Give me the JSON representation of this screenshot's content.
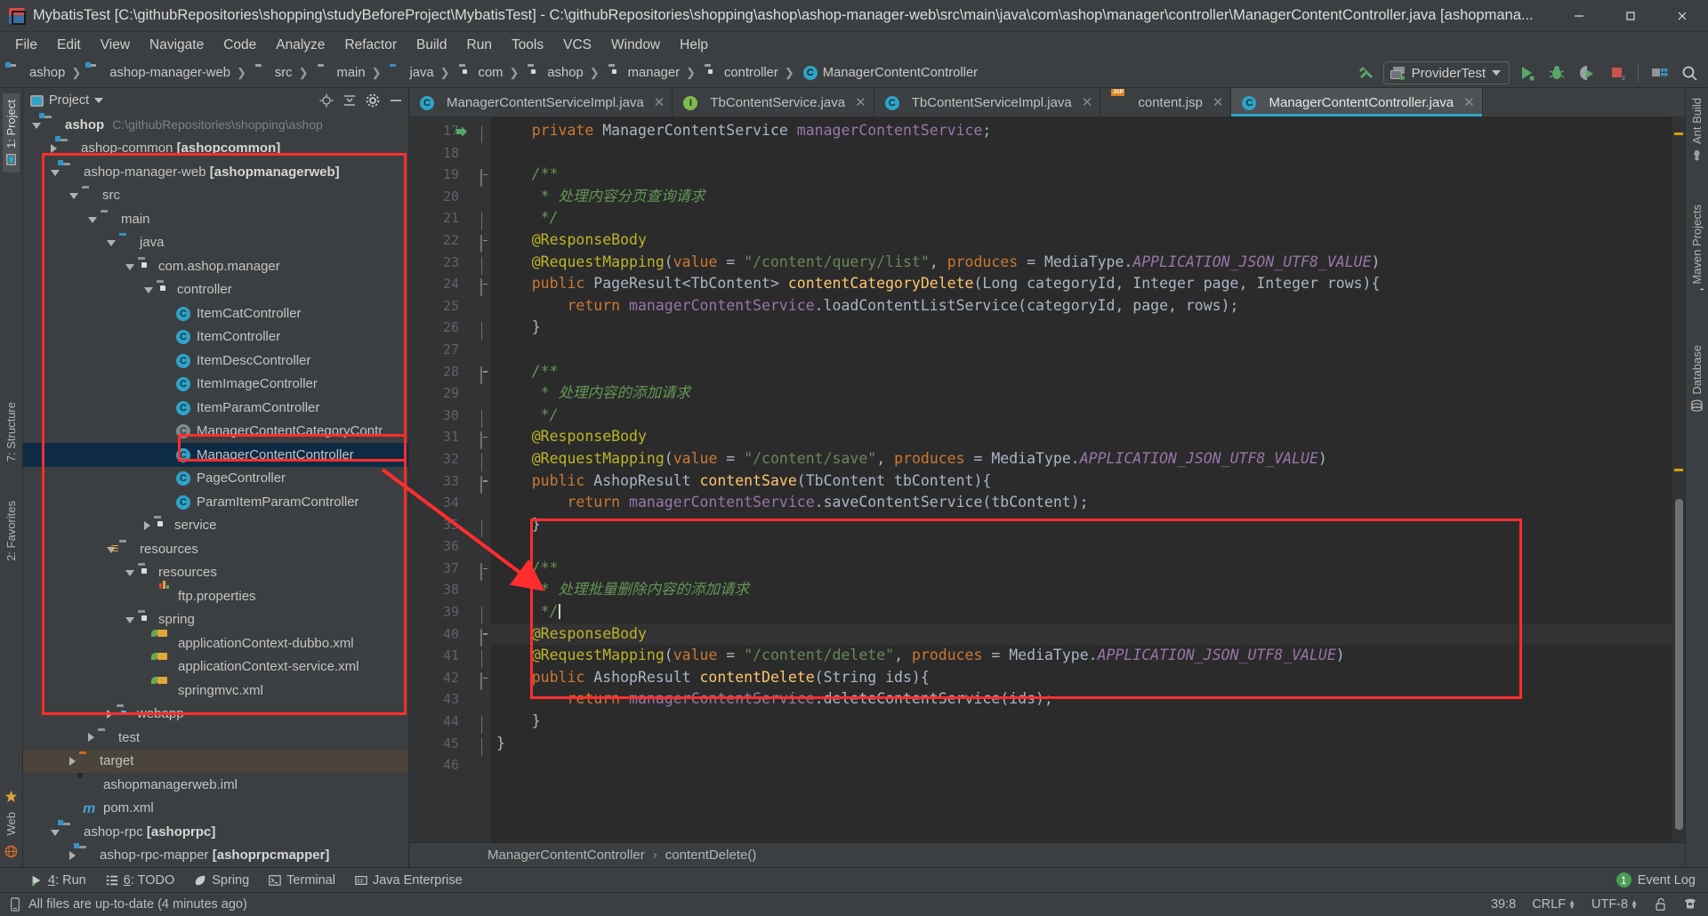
{
  "window": {
    "title": "MybatisTest [C:\\githubRepositories\\shopping\\studyBeforeProject\\MybatisTest] - C:\\githubRepositories\\shopping\\ashop\\ashop-manager-web\\src\\main\\java\\com\\ashop\\manager\\controller\\ManagerContentController.java [ashopmana...",
    "app_icon": "intellij-idea-icon",
    "minimize": "–",
    "maximize": "❐",
    "close": "✕"
  },
  "menubar": [
    {
      "label": "File"
    },
    {
      "label": "Edit"
    },
    {
      "label": "View"
    },
    {
      "label": "Navigate"
    },
    {
      "label": "Code"
    },
    {
      "label": "Analyze"
    },
    {
      "label": "Refactor"
    },
    {
      "label": "Build"
    },
    {
      "label": "Run"
    },
    {
      "label": "Tools"
    },
    {
      "label": "VCS"
    },
    {
      "label": "Window"
    },
    {
      "label": "Help"
    }
  ],
  "navbar": {
    "crumbs": [
      {
        "label": "ashop",
        "icon": "module-folder-icon",
        "active": false
      },
      {
        "label": "ashop-manager-web",
        "icon": "module-folder-icon",
        "active": false
      },
      {
        "label": "src",
        "icon": "folder-icon",
        "active": false
      },
      {
        "label": "main",
        "icon": "folder-icon",
        "active": false
      },
      {
        "label": "java",
        "icon": "source-folder-icon",
        "active": false
      },
      {
        "label": "com",
        "icon": "package-icon",
        "active": false
      },
      {
        "label": "ashop",
        "icon": "package-icon",
        "active": false
      },
      {
        "label": "manager",
        "icon": "package-icon",
        "active": false
      },
      {
        "label": "controller",
        "icon": "package-icon",
        "active": false
      },
      {
        "label": "ManagerContentController",
        "icon": "class-icon",
        "active": true
      }
    ],
    "run_config": "ProviderTest",
    "toolbar_icons": [
      "build-hammer-icon",
      "run-icon",
      "debug-icon",
      "run-with-coverage-icon",
      "stop-icon",
      "project-structure-icon",
      "search-everywhere-icon"
    ]
  },
  "left_rail": [
    {
      "label": "1: Project",
      "icon": "project-icon",
      "selected": true
    },
    {
      "label": "7: Structure",
      "icon": "structure-icon",
      "selected": false
    },
    {
      "label": "2: Favorites",
      "icon": "favorites-icon",
      "selected": false
    },
    {
      "label": "Web",
      "icon": "web-icon",
      "selected": false
    }
  ],
  "right_rail": [
    {
      "label": "Ant Build",
      "icon": "ant-icon"
    },
    {
      "label": "Maven Projects",
      "icon": "maven-icon"
    },
    {
      "label": "Database",
      "icon": "database-icon"
    }
  ],
  "project_panel": {
    "title": "Project",
    "actions": [
      "locate-icon",
      "collapse-all-icon",
      "settings-gear-icon",
      "hide-icon"
    ],
    "tree": [
      {
        "depth": 0,
        "arrow": "down",
        "icon": "module-folder-icon",
        "label": "ashop",
        "bold": true,
        "path": "C:\\githubRepositories\\shopping\\ashop",
        "state": "normal"
      },
      {
        "depth": 1,
        "arrow": "right",
        "icon": "module-folder-icon",
        "label": "ashop-common ",
        "boldsuffix": "[ashopcommon]",
        "state": "normal"
      },
      {
        "depth": 1,
        "arrow": "down",
        "icon": "module-folder-icon",
        "label": "ashop-manager-web ",
        "boldsuffix": "[ashopmanagerweb]",
        "state": "normal"
      },
      {
        "depth": 2,
        "arrow": "down",
        "icon": "folder-icon",
        "label": "src",
        "state": "normal"
      },
      {
        "depth": 3,
        "arrow": "down",
        "icon": "folder-icon",
        "label": "main",
        "state": "normal"
      },
      {
        "depth": 4,
        "arrow": "down",
        "icon": "source-folder-icon",
        "label": "java",
        "state": "normal"
      },
      {
        "depth": 5,
        "arrow": "down",
        "icon": "package-icon",
        "label": "com.ashop.manager",
        "state": "normal"
      },
      {
        "depth": 6,
        "arrow": "down",
        "icon": "package-icon",
        "label": "controller",
        "state": "normal"
      },
      {
        "depth": 7,
        "arrow": "none",
        "icon": "class-icon",
        "label": "ItemCatController",
        "state": "normal"
      },
      {
        "depth": 7,
        "arrow": "none",
        "icon": "class-icon",
        "label": "ItemController",
        "state": "normal"
      },
      {
        "depth": 7,
        "arrow": "none",
        "icon": "class-icon",
        "label": "ItemDescController",
        "state": "normal"
      },
      {
        "depth": 7,
        "arrow": "none",
        "icon": "class-icon",
        "label": "ItemImageController",
        "state": "normal"
      },
      {
        "depth": 7,
        "arrow": "none",
        "icon": "class-icon",
        "label": "ItemParamController",
        "state": "normal"
      },
      {
        "depth": 7,
        "arrow": "none",
        "icon": "class-icon-dim",
        "label": "ManagerContentCategoryContr",
        "state": "normal"
      },
      {
        "depth": 7,
        "arrow": "none",
        "icon": "class-icon",
        "label": "ManagerContentController",
        "state": "selected"
      },
      {
        "depth": 7,
        "arrow": "none",
        "icon": "class-icon",
        "label": "PageController",
        "state": "normal"
      },
      {
        "depth": 7,
        "arrow": "none",
        "icon": "class-icon",
        "label": "ParamItemParamController",
        "state": "normal"
      },
      {
        "depth": 6,
        "arrow": "right",
        "icon": "package-icon",
        "label": "service",
        "state": "normal"
      },
      {
        "depth": 4,
        "arrow": "down",
        "icon": "resources-folder-icon",
        "label": "resources",
        "state": "normal"
      },
      {
        "depth": 5,
        "arrow": "down",
        "icon": "package-icon",
        "label": "resources",
        "state": "normal"
      },
      {
        "depth": 6,
        "arrow": "none",
        "icon": "properties-icon",
        "label": "ftp.properties",
        "state": "normal"
      },
      {
        "depth": 5,
        "arrow": "down",
        "icon": "package-icon",
        "label": "spring",
        "state": "normal"
      },
      {
        "depth": 6,
        "arrow": "none",
        "icon": "xml-spring-icon",
        "label": "applicationContext-dubbo.xml",
        "state": "normal"
      },
      {
        "depth": 6,
        "arrow": "none",
        "icon": "xml-spring-icon",
        "label": "applicationContext-service.xml",
        "state": "normal"
      },
      {
        "depth": 6,
        "arrow": "none",
        "icon": "xml-spring-icon",
        "label": "springmvc.xml",
        "state": "normal"
      },
      {
        "depth": 4,
        "arrow": "right",
        "icon": "web-folder-icon",
        "label": "webapp",
        "state": "normal"
      },
      {
        "depth": 3,
        "arrow": "right",
        "icon": "folder-icon",
        "label": "test",
        "state": "normal"
      },
      {
        "depth": 2,
        "arrow": "right",
        "icon": "target-folder-icon",
        "label": "target",
        "state": "target"
      },
      {
        "depth": 2,
        "arrow": "none",
        "icon": "iml-icon",
        "label": "ashopmanagerweb.iml",
        "state": "normal"
      },
      {
        "depth": 2,
        "arrow": "none",
        "icon": "maven-pom-icon",
        "label": "pom.xml",
        "state": "normal"
      },
      {
        "depth": 1,
        "arrow": "down",
        "icon": "module-folder-icon",
        "label": "ashop-rpc ",
        "boldsuffix": "[ashoprpc]",
        "state": "normal"
      },
      {
        "depth": 2,
        "arrow": "right",
        "icon": "module-folder-icon",
        "label": "ashop-rpc-mapper ",
        "boldsuffix": "[ashoprpcmapper]",
        "state": "normal"
      }
    ]
  },
  "editor": {
    "tabs": [
      {
        "label": "ManagerContentServiceImpl.java",
        "icon": "class-icon",
        "active": false,
        "closable": true
      },
      {
        "label": "TbContentService.java",
        "icon": "interface-icon",
        "active": false,
        "closable": true
      },
      {
        "label": "TbContentServiceImpl.java",
        "icon": "class-icon",
        "active": false,
        "closable": true
      },
      {
        "label": "content.jsp",
        "icon": "jsp-icon",
        "active": false,
        "closable": true
      },
      {
        "label": "ManagerContentController.java",
        "icon": "class-icon",
        "active": true,
        "closable": true
      }
    ],
    "first_line_number": 17,
    "lines": [
      {
        "n": 17,
        "fold": "bracket",
        "green_arrow": true,
        "tokens": [
          {
            "t": "    ",
            "c": ""
          },
          {
            "t": "private",
            "c": "kw"
          },
          {
            "t": " ManagerContentService ",
            "c": "typ"
          },
          {
            "t": "managerContentService",
            "c": "fld"
          },
          {
            "t": ";",
            "c": ""
          }
        ]
      },
      {
        "n": 18,
        "fold": "",
        "tokens": []
      },
      {
        "n": 19,
        "fold": "box",
        "tokens": [
          {
            "t": "    ",
            "c": ""
          },
          {
            "t": "/**",
            "c": "cmt"
          }
        ]
      },
      {
        "n": 20,
        "fold": "",
        "tokens": [
          {
            "t": "     * 处理内容分页查询请求",
            "c": "cmt"
          }
        ]
      },
      {
        "n": 21,
        "fold": "bracket",
        "tokens": [
          {
            "t": "     */",
            "c": "cmt"
          }
        ]
      },
      {
        "n": 22,
        "fold": "box",
        "tokens": [
          {
            "t": "    ",
            "c": ""
          },
          {
            "t": "@ResponseBody",
            "c": "ann"
          }
        ]
      },
      {
        "n": 23,
        "fold": "bracket",
        "tokens": [
          {
            "t": "    ",
            "c": ""
          },
          {
            "t": "@RequestMapping",
            "c": "ann"
          },
          {
            "t": "(",
            "c": ""
          },
          {
            "t": "value",
            "c": "kw"
          },
          {
            "t": " = ",
            "c": ""
          },
          {
            "t": "\"/content/query/list\"",
            "c": "str"
          },
          {
            "t": ", ",
            "c": ""
          },
          {
            "t": "produces",
            "c": "kw"
          },
          {
            "t": " = MediaType.",
            "c": ""
          },
          {
            "t": "APPLICATION_JSON_UTF8_VALUE",
            "c": "sfld"
          },
          {
            "t": ")",
            "c": ""
          }
        ]
      },
      {
        "n": 24,
        "fold": "box",
        "tokens": [
          {
            "t": "    ",
            "c": ""
          },
          {
            "t": "public",
            "c": "kw"
          },
          {
            "t": " PageResult<TbContent> ",
            "c": "typ"
          },
          {
            "t": "contentCategoryDelete",
            "c": "mth"
          },
          {
            "t": "(Long categoryId, Integer page, Integer rows){",
            "c": ""
          }
        ]
      },
      {
        "n": 25,
        "fold": "",
        "tokens": [
          {
            "t": "        ",
            "c": ""
          },
          {
            "t": "return",
            "c": "kw"
          },
          {
            "t": " ",
            "c": ""
          },
          {
            "t": "managerContentService",
            "c": "fld"
          },
          {
            "t": ".loadContentListService(categoryId, page, rows);",
            "c": ""
          }
        ]
      },
      {
        "n": 26,
        "fold": "bracket",
        "tokens": [
          {
            "t": "    }",
            "c": ""
          }
        ]
      },
      {
        "n": 27,
        "fold": "",
        "tokens": []
      },
      {
        "n": 28,
        "fold": "box",
        "tokens": [
          {
            "t": "    ",
            "c": ""
          },
          {
            "t": "/**",
            "c": "cmt"
          }
        ]
      },
      {
        "n": 29,
        "fold": "",
        "tokens": [
          {
            "t": "     * 处理内容的添加请求",
            "c": "cmt"
          }
        ]
      },
      {
        "n": 30,
        "fold": "bracket",
        "tokens": [
          {
            "t": "     */",
            "c": "cmt"
          }
        ]
      },
      {
        "n": 31,
        "fold": "box",
        "tokens": [
          {
            "t": "    ",
            "c": ""
          },
          {
            "t": "@ResponseBody",
            "c": "ann"
          }
        ]
      },
      {
        "n": 32,
        "fold": "bracket",
        "tokens": [
          {
            "t": "    ",
            "c": ""
          },
          {
            "t": "@RequestMapping",
            "c": "ann"
          },
          {
            "t": "(",
            "c": ""
          },
          {
            "t": "value",
            "c": "kw"
          },
          {
            "t": " = ",
            "c": ""
          },
          {
            "t": "\"/content/save\"",
            "c": "str"
          },
          {
            "t": ", ",
            "c": ""
          },
          {
            "t": "produces",
            "c": "kw"
          },
          {
            "t": " = MediaType.",
            "c": ""
          },
          {
            "t": "APPLICATION_JSON_UTF8_VALUE",
            "c": "sfld"
          },
          {
            "t": ")",
            "c": ""
          }
        ]
      },
      {
        "n": 33,
        "fold": "box",
        "tokens": [
          {
            "t": "    ",
            "c": ""
          },
          {
            "t": "public",
            "c": "kw"
          },
          {
            "t": " AshopResult ",
            "c": "typ"
          },
          {
            "t": "contentSave",
            "c": "mth"
          },
          {
            "t": "(TbContent tbContent){",
            "c": ""
          }
        ]
      },
      {
        "n": 34,
        "fold": "",
        "tokens": [
          {
            "t": "        ",
            "c": ""
          },
          {
            "t": "return",
            "c": "kw"
          },
          {
            "t": " ",
            "c": ""
          },
          {
            "t": "managerContentService",
            "c": "fld"
          },
          {
            "t": ".saveContentService(tbContent);",
            "c": ""
          }
        ]
      },
      {
        "n": 35,
        "fold": "bracket",
        "tokens": [
          {
            "t": "    }",
            "c": ""
          }
        ]
      },
      {
        "n": 36,
        "fold": "",
        "tokens": []
      },
      {
        "n": 37,
        "fold": "box",
        "tokens": [
          {
            "t": "    ",
            "c": ""
          },
          {
            "t": "/**",
            "c": "cmt"
          }
        ]
      },
      {
        "n": 38,
        "fold": "",
        "tokens": [
          {
            "t": "     * 处理批量删除内容的添加请求",
            "c": "cmt"
          }
        ]
      },
      {
        "n": 39,
        "fold": "bracket",
        "caret": true,
        "tokens": [
          {
            "t": "     */",
            "c": "cmt"
          }
        ]
      },
      {
        "n": 40,
        "fold": "box",
        "highlight": true,
        "tokens": [
          {
            "t": "    ",
            "c": ""
          },
          {
            "t": "@ResponseBody",
            "c": "ann"
          }
        ]
      },
      {
        "n": 41,
        "fold": "bracket",
        "tokens": [
          {
            "t": "    ",
            "c": ""
          },
          {
            "t": "@RequestMapping",
            "c": "ann"
          },
          {
            "t": "(",
            "c": ""
          },
          {
            "t": "value",
            "c": "kw"
          },
          {
            "t": " = ",
            "c": ""
          },
          {
            "t": "\"/content/delete\"",
            "c": "str"
          },
          {
            "t": ", ",
            "c": ""
          },
          {
            "t": "produces",
            "c": "kw"
          },
          {
            "t": " = MediaType.",
            "c": ""
          },
          {
            "t": "APPLICATION_JSON_UTF8_VALUE",
            "c": "sfld"
          },
          {
            "t": ")",
            "c": ""
          }
        ]
      },
      {
        "n": 42,
        "fold": "box",
        "tokens": [
          {
            "t": "    ",
            "c": ""
          },
          {
            "t": "public",
            "c": "kw"
          },
          {
            "t": " AshopResult ",
            "c": "typ"
          },
          {
            "t": "contentDelete",
            "c": "mth"
          },
          {
            "t": "(String ids){",
            "c": ""
          }
        ]
      },
      {
        "n": 43,
        "fold": "",
        "tokens": [
          {
            "t": "        ",
            "c": ""
          },
          {
            "t": "return",
            "c": "kw"
          },
          {
            "t": " ",
            "c": ""
          },
          {
            "t": "managerContentService",
            "c": "fld"
          },
          {
            "t": ".deleteContentService(ids);",
            "c": ""
          }
        ]
      },
      {
        "n": 44,
        "fold": "bracket",
        "tokens": [
          {
            "t": "    }",
            "c": ""
          }
        ]
      },
      {
        "n": 45,
        "fold": "bracket",
        "tokens": [
          {
            "t": "}",
            "c": ""
          }
        ]
      },
      {
        "n": 46,
        "fold": "",
        "tokens": []
      }
    ],
    "breadcrumb": {
      "class": "ManagerContentController",
      "separator": "›",
      "method": "contentDelete()"
    }
  },
  "annotations": {
    "box_color": "#ff2d2d",
    "boxes": [
      "project-tree-module-box",
      "selected-class-box",
      "code-method-box"
    ],
    "arrow": "red-arrow-pointing-to-code"
  },
  "bottom_tools": [
    {
      "num": "4",
      "label": ": Run",
      "icon": "run-icon"
    },
    {
      "num": "6",
      "label": ": TODO",
      "icon": "todo-icon"
    },
    {
      "num": "",
      "label": "Spring",
      "icon": "spring-leaf-icon"
    },
    {
      "num": "",
      "label": "Terminal",
      "icon": "terminal-icon"
    },
    {
      "num": "",
      "label": "Java Enterprise",
      "icon": "java-ee-icon"
    }
  ],
  "event_log": {
    "count": "1",
    "label": "Event Log"
  },
  "statusbar": {
    "message": "All files are up-to-date (4 minutes ago)",
    "message_icon": "file-sync-icon",
    "caret_position": "39:8",
    "line_separator": "CRLF",
    "encoding": "UTF-8",
    "lock_icon": "unlocked-icon",
    "inspector_icon": "hector-icon"
  }
}
